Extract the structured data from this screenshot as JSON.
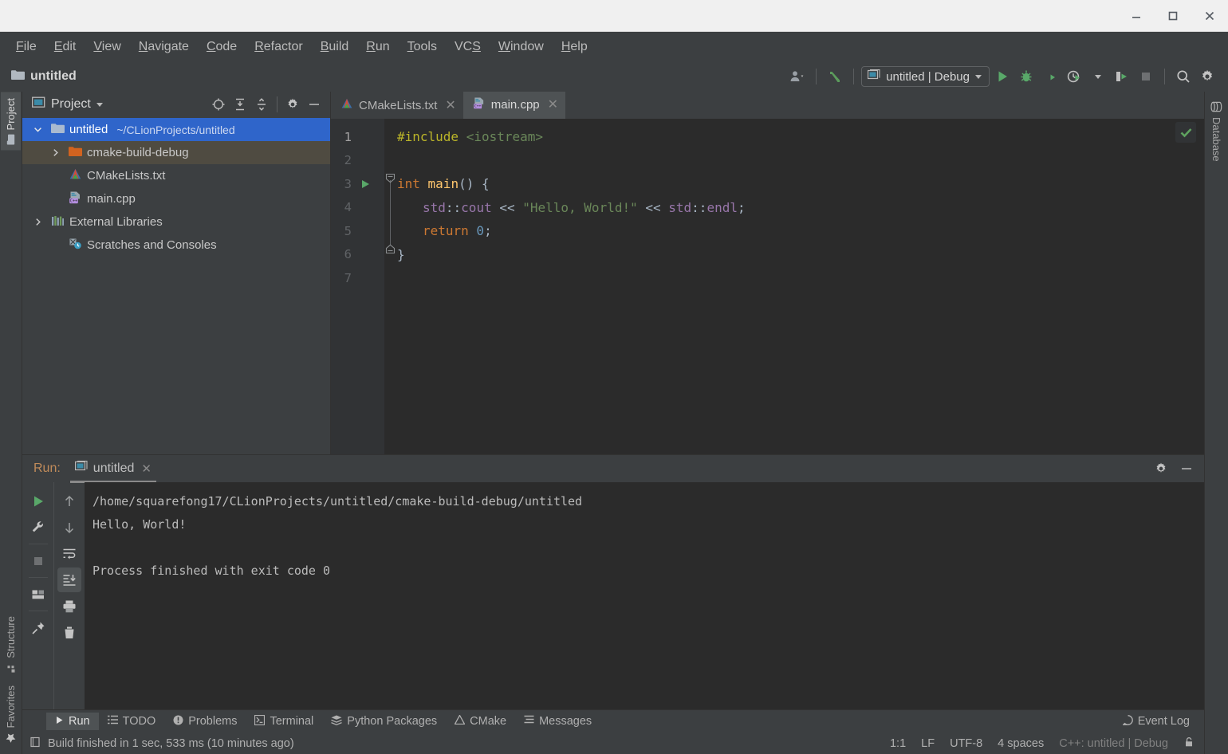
{
  "window": {
    "controls": [
      {
        "name": "minimize-button",
        "label": "–"
      },
      {
        "name": "maximize-button",
        "label": "□"
      },
      {
        "name": "close-button",
        "label": "×"
      }
    ]
  },
  "menubar": [
    {
      "pre": "",
      "mn": "F",
      "post": "ile"
    },
    {
      "pre": "",
      "mn": "E",
      "post": "dit"
    },
    {
      "pre": "",
      "mn": "V",
      "post": "iew"
    },
    {
      "pre": "",
      "mn": "N",
      "post": "avigate"
    },
    {
      "pre": "",
      "mn": "C",
      "post": "ode"
    },
    {
      "pre": "",
      "mn": "R",
      "post": "efactor"
    },
    {
      "pre": "",
      "mn": "B",
      "post": "uild"
    },
    {
      "pre": "",
      "mn": "R",
      "post": "un"
    },
    {
      "pre": "",
      "mn": "T",
      "post": "ools"
    },
    {
      "pre": "VC",
      "mn": "S",
      "post": ""
    },
    {
      "pre": "",
      "mn": "W",
      "post": "indow"
    },
    {
      "pre": "",
      "mn": "H",
      "post": "elp"
    }
  ],
  "navbar": {
    "project_name": "untitled",
    "run_config": "untitled | Debug"
  },
  "project_panel": {
    "title": "Project",
    "tree": [
      {
        "label": "untitled",
        "path": "~/CLionProjects/untitled",
        "indent": 0,
        "arrow": "down",
        "icon": "folder-module-icon",
        "state": "selected"
      },
      {
        "label": "cmake-build-debug",
        "path": "",
        "indent": 1,
        "arrow": "right",
        "icon": "folder-excluded-icon",
        "state": "hover"
      },
      {
        "label": "CMakeLists.txt",
        "path": "",
        "indent": 1,
        "arrow": "none",
        "icon": "cmake-file-icon",
        "state": "none"
      },
      {
        "label": "main.cpp",
        "path": "",
        "indent": 1,
        "arrow": "none",
        "icon": "cpp-file-icon",
        "state": "none"
      },
      {
        "label": "External Libraries",
        "path": "",
        "indent": 0,
        "arrow": "right",
        "icon": "libraries-icon",
        "state": "none"
      },
      {
        "label": "Scratches and Consoles",
        "path": "",
        "indent": 0,
        "arrow": "none",
        "icon": "scratches-icon",
        "state": "none"
      }
    ]
  },
  "editor": {
    "tabs": [
      {
        "label": "CMakeLists.txt",
        "icon": "cmake-file-icon",
        "active": false
      },
      {
        "label": "main.cpp",
        "icon": "cpp-file-icon",
        "active": true
      }
    ],
    "lines": [
      {
        "num": "1",
        "current": true
      },
      {
        "num": "2",
        "current": false
      },
      {
        "num": "3",
        "current": false,
        "run_marker": true
      },
      {
        "num": "4",
        "current": false
      },
      {
        "num": "5",
        "current": false
      },
      {
        "num": "6",
        "current": false
      },
      {
        "num": "7",
        "current": false
      }
    ],
    "code": {
      "l1_include": "#include",
      "l1_lib": "<iostream>",
      "l3_type": "int",
      "l3_fn": " main",
      "l3_rest": "() {",
      "l4_std": "std",
      "l4_sep1": "::",
      "l4_cout": "cout",
      "l4_shift1": " << ",
      "l4_str": "\"Hello, World!\"",
      "l4_shift2": " << ",
      "l4_std2": "std",
      "l4_sep2": "::",
      "l4_endl": "endl",
      "l4_semi": ";",
      "l5_return": "return",
      "l5_num": " 0",
      "l5_semi": ";",
      "l6_brace": "}"
    }
  },
  "run_panel": {
    "label": "Run:",
    "tab_title": "untitled",
    "console": [
      "/home/squarefong17/CLionProjects/untitled/cmake-build-debug/untitled",
      "Hello, World!",
      "",
      "Process finished with exit code 0"
    ],
    "left_buttons": [
      {
        "name": "rerun-button",
        "icon": "play-icon"
      },
      {
        "name": "run-configurations-button",
        "icon": "wrench-icon"
      },
      {
        "name": "stop-button",
        "icon": "stop-icon"
      },
      {
        "name": "layout-button",
        "icon": "layout-icon"
      },
      {
        "name": "pin-tab-button",
        "icon": "pin-icon"
      }
    ],
    "right_buttons": [
      {
        "name": "previous-occurrence-button",
        "icon": "arrow-up-icon"
      },
      {
        "name": "next-occurrence-button",
        "icon": "arrow-down-icon"
      },
      {
        "name": "soft-wrap-button",
        "icon": "soft-wrap-icon"
      },
      {
        "name": "scroll-to-end-button",
        "icon": "scroll-to-end-icon"
      },
      {
        "name": "print-button",
        "icon": "print-icon"
      },
      {
        "name": "clear-all-button",
        "icon": "trash-icon"
      }
    ]
  },
  "left_rail": {
    "top": [
      {
        "label": "Project",
        "icon": "project-icon",
        "active": true
      }
    ],
    "bottom": [
      {
        "label": "Structure",
        "icon": "structure-icon",
        "active": false
      },
      {
        "label": "Favorites",
        "icon": "star-icon",
        "active": false
      }
    ]
  },
  "right_rail": {
    "items": [
      {
        "label": "Database",
        "icon": "database-icon",
        "active": false
      }
    ]
  },
  "bottom_tabs": [
    {
      "label": "Run",
      "icon": "play-icon",
      "active": true
    },
    {
      "label": "TODO",
      "icon": "todo-icon",
      "active": false
    },
    {
      "label": "Problems",
      "icon": "problems-icon",
      "active": false
    },
    {
      "label": "Terminal",
      "icon": "terminal-icon",
      "active": false
    },
    {
      "label": "Python Packages",
      "icon": "python-packages-icon",
      "active": false
    },
    {
      "label": "CMake",
      "icon": "cmake-icon",
      "active": false
    },
    {
      "label": "Messages",
      "icon": "messages-icon",
      "active": false
    }
  ],
  "event_log": "Event Log",
  "statusbar": {
    "message": "Build finished in 1 sec, 533 ms (10 minutes ago)",
    "caret": "1:1",
    "line_separator": "LF",
    "encoding": "UTF-8",
    "indent": "4 spaces",
    "config": "C++: untitled | Debug"
  },
  "colors": {
    "accent_green": "#4f9c4f",
    "selection_blue": "#2f65ca",
    "panel_bg": "#3c3f41",
    "editor_bg": "#2b2b2b",
    "gutter_bg": "#313335"
  }
}
